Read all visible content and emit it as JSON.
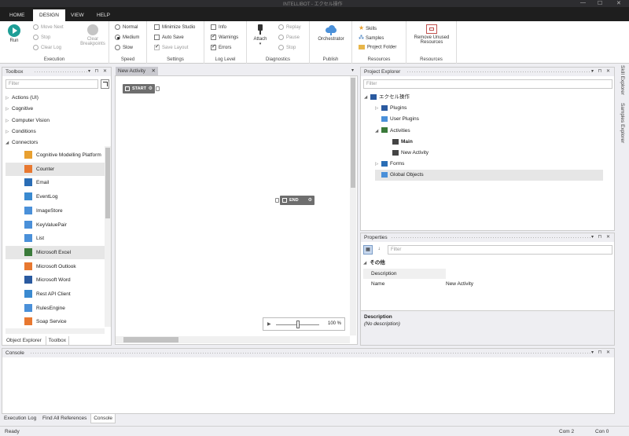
{
  "window": {
    "title": "INTELLIBOT - エクセル操作",
    "minimize": "—",
    "maximize": "☐",
    "close": "✕"
  },
  "tabs": [
    {
      "label": "HOME",
      "active": false
    },
    {
      "label": "DESIGN",
      "active": true
    },
    {
      "label": "VIEW",
      "active": false
    },
    {
      "label": "HELP",
      "active": false
    }
  ],
  "ribbon": {
    "execution": {
      "label": "Execution",
      "run": "Run",
      "move_next": "Move Next",
      "stop": "Stop",
      "clear_log": "Clear Log",
      "clear_breakpoints_1": "Clear",
      "clear_breakpoints_2": "Breakpoints"
    },
    "speed": {
      "label": "Speed",
      "options": [
        "Normal",
        "Medium",
        "Slow"
      ],
      "selected": "Medium"
    },
    "settings": {
      "label": "Settings",
      "minimize_studio": "Minimize Studio",
      "auto_save": "Auto Save",
      "save_layout": "Save Layout"
    },
    "log_level": {
      "label": "Log Level",
      "info": "Info",
      "warnings": "Warnings",
      "errors": "Errors"
    },
    "diagnostics": {
      "label": "Diagnostics",
      "attach": "Attach",
      "replay": "Replay",
      "pause": "Pause",
      "stop": "Stop"
    },
    "publish": {
      "label": "Publish",
      "orchestrator": "Orchestrator"
    },
    "resources": {
      "label": "Resources",
      "skills": "Skills",
      "samples": "Samples",
      "project_folder": "Project Folder"
    },
    "resources2": {
      "label": "Resources",
      "remove_unused_1": "Remove Unused",
      "remove_unused_2": "Resources"
    }
  },
  "toolbox": {
    "title": "Toolbox",
    "filter_placeholder": "Filter",
    "categories": [
      {
        "label": "Actions (UI)",
        "expanded": false
      },
      {
        "label": "Cognitive",
        "expanded": false
      },
      {
        "label": "Computer Vision",
        "expanded": false
      },
      {
        "label": "Conditions",
        "expanded": false
      },
      {
        "label": "Connectors",
        "expanded": true
      }
    ],
    "items": [
      {
        "label": "Cognitive Modelling Platform",
        "color": "#e8a030",
        "hl": false
      },
      {
        "label": "Counter",
        "color": "#e87830",
        "hl": true
      },
      {
        "label": "Email",
        "color": "#2a6db5",
        "hl": false
      },
      {
        "label": "EventLog",
        "color": "#3a8ad0",
        "hl": false
      },
      {
        "label": "ImageStore",
        "color": "#4a90d9",
        "hl": false
      },
      {
        "label": "KeyValuePair",
        "color": "#4a90d9",
        "hl": false
      },
      {
        "label": "List",
        "color": "#4a90d9",
        "hl": false
      },
      {
        "label": "Microsoft Excel",
        "color": "#3a7a3a",
        "hl": true
      },
      {
        "label": "Microsoft Outlook",
        "color": "#e87830",
        "hl": false
      },
      {
        "label": "Microsoft Word",
        "color": "#2a5aa0",
        "hl": false
      },
      {
        "label": "Rest API Client",
        "color": "#3a8ad0",
        "hl": false
      },
      {
        "label": "RulesEngine",
        "color": "#4a90d9",
        "hl": false
      },
      {
        "label": "Soap Service",
        "color": "#e87830",
        "hl": false
      }
    ],
    "bottom_tabs": [
      {
        "label": "Object Explorer",
        "active": false
      },
      {
        "label": "Toolbox",
        "active": true
      }
    ]
  },
  "designer": {
    "tab_label": "New Activity",
    "start_label": "START",
    "end_label": "END",
    "zoom_value": 50,
    "zoom_text": "100 %"
  },
  "project_explorer": {
    "title": "Project Explorer",
    "filter_placeholder": "Filter",
    "items": [
      {
        "label": "エクセル操作",
        "level": 0,
        "arrow": "◢"
      },
      {
        "label": "Plugins",
        "level": 1,
        "arrow": "▷"
      },
      {
        "label": "User Plugins",
        "level": 1,
        "arrow": ""
      },
      {
        "label": "Activities",
        "level": 1,
        "arrow": "◢"
      },
      {
        "label": "Main",
        "level": 2,
        "arrow": ""
      },
      {
        "label": "New Activity",
        "level": 2,
        "arrow": ""
      },
      {
        "label": "Forms",
        "level": 1,
        "arrow": "▷"
      },
      {
        "label": "Global Objects",
        "level": 1,
        "arrow": ""
      }
    ]
  },
  "properties": {
    "title": "Properties",
    "filter_placeholder": "Filter",
    "group": "その他",
    "rows": [
      {
        "name": "Description",
        "value": ""
      },
      {
        "name": "Name",
        "value": "New Activity"
      }
    ],
    "desc_title": "Description",
    "desc_text": "(No description)"
  },
  "side_tabs": [
    "Skill Explorer",
    "Samples Explorer"
  ],
  "console": {
    "title": "Console",
    "bottom_tabs": [
      {
        "label": "Execution Log",
        "active": false
      },
      {
        "label": "Find All References",
        "active": false
      },
      {
        "label": "Console",
        "active": true
      }
    ]
  },
  "status": {
    "ready": "Ready",
    "com": "Com 2",
    "con": "Con 0"
  },
  "panel_controls": "▾ ⊓ ✕"
}
